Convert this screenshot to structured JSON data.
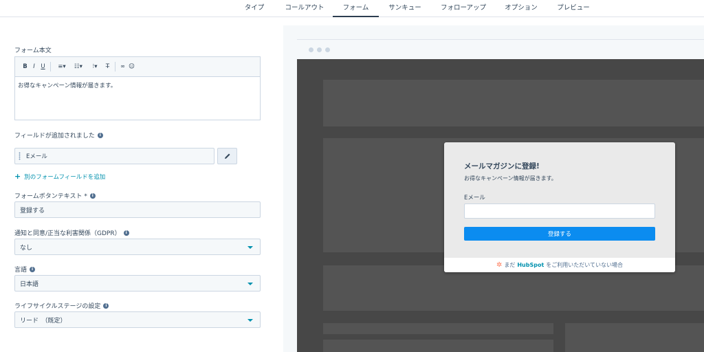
{
  "tabs": [
    {
      "label": "タイプ"
    },
    {
      "label": "コールアウト"
    },
    {
      "label": "フォーム"
    },
    {
      "label": "サンキュー"
    },
    {
      "label": "フォローアップ"
    },
    {
      "label": "オプション"
    },
    {
      "label": "プレビュー"
    }
  ],
  "active_tab": "フォーム",
  "form_body": {
    "label": "フォーム本文",
    "toolbar": [
      "B",
      "I",
      "U"
    ],
    "content": "お得なキャンペーン情報が届きます。"
  },
  "fields": {
    "label": "フィールドが追加されました",
    "items": [
      {
        "label": "Eメール"
      }
    ],
    "add_link": "別のフォームフィールドを追加"
  },
  "button_text": {
    "label": "フォームボタンテキスト *",
    "value": "登録する"
  },
  "gdpr": {
    "label": "通知と同意/正当な利害関係（GDPR）",
    "value": "なし"
  },
  "language": {
    "label": "言語",
    "value": "日本語"
  },
  "lifecycle": {
    "label": "ライフサイクルステージの設定",
    "value": "リード　（既定）"
  },
  "preview": {
    "title": "メールマガジンに登録!",
    "subtitle": "お得なキャンペーン情報が届きます。",
    "field_label": "Eメール",
    "button": "登録する",
    "footer_pre": "まだ",
    "footer_brand": "HubSpot",
    "footer_post": "をご利用いただいていない場合"
  },
  "colors": {
    "accent": "#0091ae",
    "primary_button": "#0b8cf0",
    "hubspot_orange": "#ff7a59"
  }
}
